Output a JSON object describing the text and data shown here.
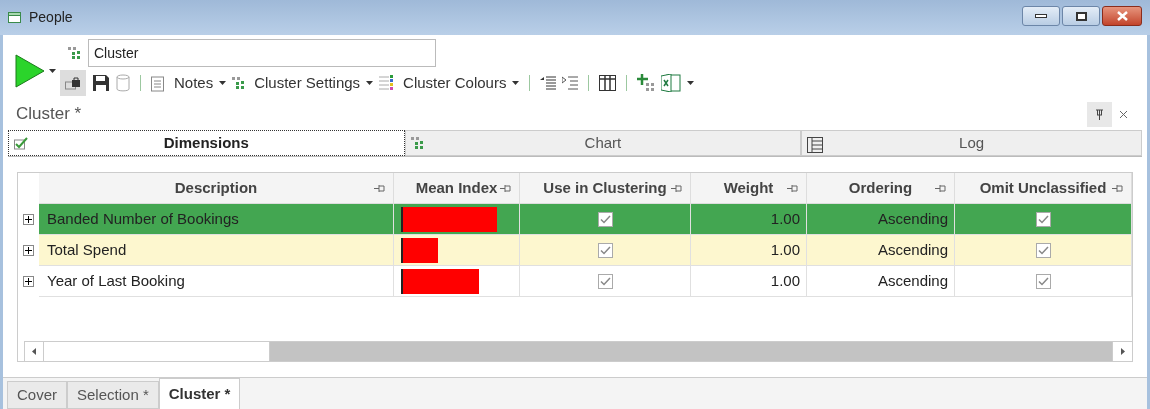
{
  "window": {
    "title": "People"
  },
  "toolbar": {
    "name_field": {
      "value": "Cluster"
    },
    "buttons": [
      {
        "label": "Notes"
      },
      {
        "label": "Cluster Settings"
      },
      {
        "label": "Cluster Colours"
      }
    ]
  },
  "panel": {
    "title": "Cluster *"
  },
  "tabs": [
    {
      "label": "Dimensions",
      "selected": true
    },
    {
      "label": "Chart",
      "selected": false
    },
    {
      "label": "Log",
      "selected": false
    }
  ],
  "table": {
    "columns": [
      "Description",
      "Mean Index",
      "Use in Clustering",
      "Weight",
      "Ordering",
      "Omit Unclassified"
    ],
    "rows": [
      {
        "description": "Banded Number of Bookings",
        "level": 0.9,
        "use_in_clustering": true,
        "weight": "1.00",
        "ordering": "Ascending",
        "omit_unclassified": true,
        "selected": true,
        "highlighted": false
      },
      {
        "description": "Total Spend",
        "level": 0.34,
        "use_in_clustering": true,
        "weight": "1.00",
        "ordering": "Ascending",
        "omit_unclassified": true,
        "selected": false,
        "highlighted": true
      },
      {
        "description": "Year of Last Booking",
        "level": 0.73,
        "use_in_clustering": true,
        "weight": "1.00",
        "ordering": "Ascending",
        "omit_unclassified": true,
        "selected": false,
        "highlighted": false
      }
    ]
  },
  "bottom_tabs": [
    {
      "label": "Cover",
      "selected": false
    },
    {
      "label": "Selection *",
      "selected": false
    },
    {
      "label": "Cluster *",
      "selected": true
    }
  ]
}
